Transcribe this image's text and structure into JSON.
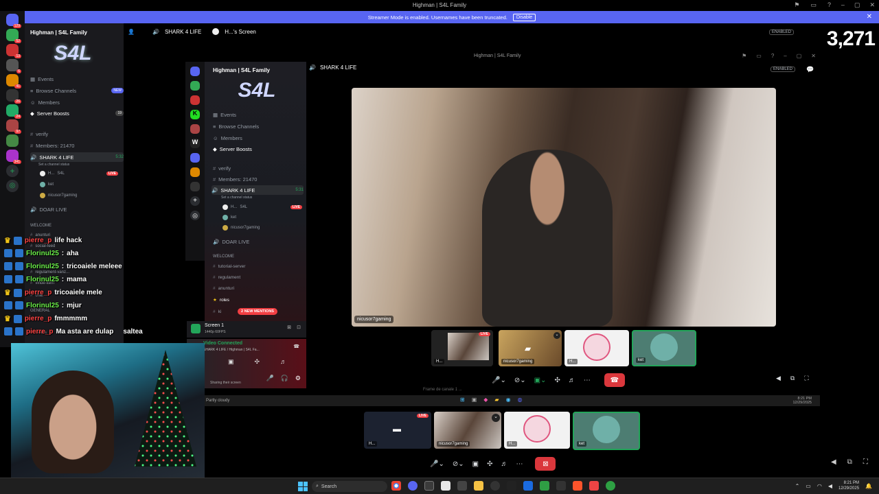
{
  "titlebar": {
    "title": "Highman | S4L Family"
  },
  "streamer_mode": {
    "text": "Streamer Mode is enabled. Usernames have been truncated.",
    "button": "Disable"
  },
  "server": {
    "name": "Highman | S4L Family",
    "banner": "S4L"
  },
  "outer_channels": {
    "events": "Events",
    "browse": "Browse Channels",
    "browse_badge": "NEW",
    "members": "Members",
    "boosts": "Server Boosts",
    "boosts_count": "19",
    "verify": "verify",
    "member_count": "Members: 21470",
    "voice": "SHARK 4 LIFE",
    "voice_time": "5:32",
    "voice_status": "Set a channel status",
    "users": [
      {
        "name": "H...",
        "tag": "S4L",
        "live": "LIVE"
      },
      {
        "name": "ket"
      },
      {
        "name": "nicusor7gaming"
      }
    ],
    "doar_live": "DOAR LIVE",
    "welcome": "WELCOME",
    "anunturi": "anunturi",
    "social": "social-feed",
    "regulament": "regulament-vanz...",
    "vinde": "vinde-item",
    "chat": "chat",
    "general": "GENERAL",
    "media": "media",
    "badges": {
      "anunturi": "25",
      "social": "49"
    }
  },
  "outer_header": {
    "channel": "SHARK 4 LIFE",
    "screen": "H...'s Screen"
  },
  "viewer": {
    "enabled": "ENABLED",
    "count": "3,271"
  },
  "inner_header": {
    "title": "Highman | S4L Family",
    "channel": "SHARK 4 LIFE",
    "enabled": "ENABLED"
  },
  "inner_channels": {
    "events": "Events",
    "browse": "Browse Channels",
    "members": "Members",
    "boosts": "Server Boosts",
    "verify": "verify",
    "member_count": "Members: 21470",
    "voice": "SHARK 4 LIFE",
    "voice_time": "5:31",
    "voice_status": "Set a channel status",
    "users": [
      "H...",
      "ket",
      "nicusor7gaming"
    ],
    "live": "LIVE",
    "tag": "S4L",
    "doar_live": "DOAR LIVE",
    "welcome": "WELCOME",
    "tutorial": "tutorial-server",
    "regulament": "regulament",
    "anunturi": "anunturi",
    "roles": "roles",
    "ki": "ki",
    "mentions": "2 NEW MENTIONS"
  },
  "screen_panel": {
    "title": "Screen 1",
    "sub": "1440p 60FPS"
  },
  "voice_panel": {
    "status": "Video Connected",
    "channel": "SHARK 4 LIFE / Highman | S4L Fa...",
    "sharing": "Sharing their screen"
  },
  "main_video": {
    "name": "nicusor7gaming"
  },
  "inner_tiles": {
    "t1": "H...",
    "t2": "nicusor7gaming",
    "t3": "H...",
    "t4": "ket",
    "live": "LIVE"
  },
  "inner_taskbar": {
    "weather": "Partly cloudy",
    "ghost_text": "Frame de canale 1 ...",
    "time": "8:21 PM",
    "date": "12/29/2025"
  },
  "chat": [
    {
      "user": "pierre_p",
      "msg": "life hack"
    },
    {
      "user": "Florinul25",
      "msg": "aha"
    },
    {
      "user": "Florinul25",
      "msg": "tricoaiele meleee"
    },
    {
      "user": "Florinul25",
      "msg": "mama"
    },
    {
      "user": "pierre_p",
      "msg": "tricoaiele mele"
    },
    {
      "user": "Florinul25",
      "msg": "mjur"
    },
    {
      "user": "pierre_p",
      "msg": "fmmmmm"
    },
    {
      "user": "pierre_p",
      "msg": "Ma asta are dulap",
      "extra": "saltea"
    }
  ],
  "outer_tiles": {
    "t1": "H...",
    "t2": "nicusor7gaming",
    "t3": "H...",
    "t4": "ket",
    "live": "LIVE"
  },
  "taskbar": {
    "search": "Search",
    "time": "8:21 PM",
    "date": "12/29/2025"
  },
  "colors": {
    "blurple": "#5865f2",
    "red": "#da373c",
    "green": "#23a55a"
  }
}
